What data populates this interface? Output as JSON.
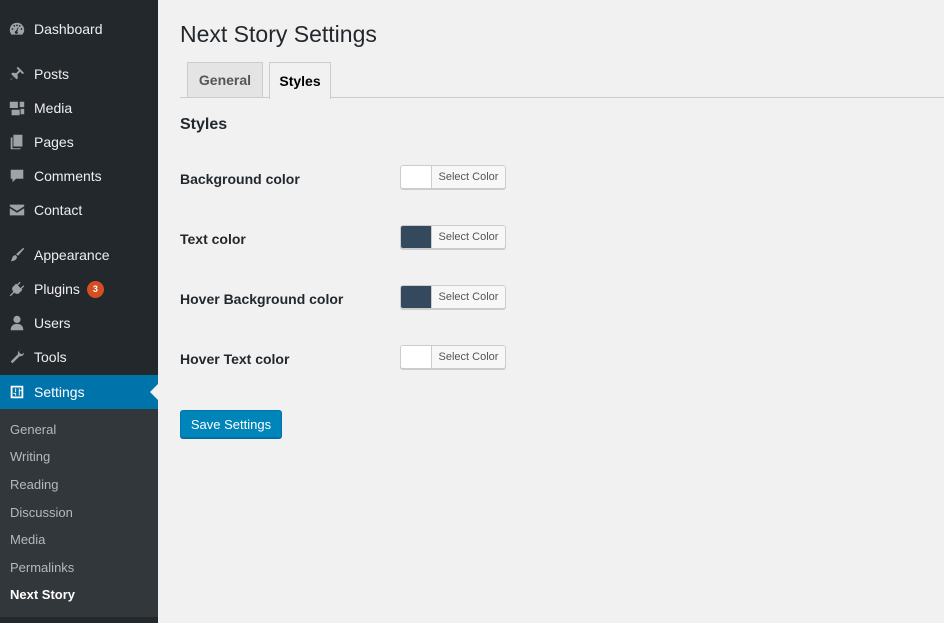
{
  "sidebar": {
    "items": [
      {
        "label": "Dashboard",
        "icon": "dashboard-icon"
      },
      {
        "label": "Posts",
        "icon": "pin-icon"
      },
      {
        "label": "Media",
        "icon": "media-icon"
      },
      {
        "label": "Pages",
        "icon": "pages-icon"
      },
      {
        "label": "Comments",
        "icon": "comment-icon"
      },
      {
        "label": "Contact",
        "icon": "envelope-icon"
      },
      {
        "label": "Appearance",
        "icon": "brush-icon"
      },
      {
        "label": "Plugins",
        "icon": "plug-icon",
        "badge": "3"
      },
      {
        "label": "Users",
        "icon": "user-icon"
      },
      {
        "label": "Tools",
        "icon": "wrench-icon"
      },
      {
        "label": "Settings",
        "icon": "settings-icon",
        "active": true
      }
    ],
    "submenu": [
      "General",
      "Writing",
      "Reading",
      "Discussion",
      "Media",
      "Permalinks",
      "Next Story"
    ],
    "submenu_current": "Next Story"
  },
  "page": {
    "title": "Next Story Settings",
    "tabs": [
      {
        "label": "General",
        "active": false
      },
      {
        "label": "Styles",
        "active": true
      }
    ],
    "section_title": "Styles",
    "fields": [
      {
        "label": "Background color",
        "button": "Select Color",
        "color": "#ffffff"
      },
      {
        "label": "Text color",
        "button": "Select Color",
        "color": "#34495e"
      },
      {
        "label": "Hover Background color",
        "button": "Select Color",
        "color": "#34495e"
      },
      {
        "label": "Hover Text color",
        "button": "Select Color",
        "color": "#ffffff"
      }
    ],
    "save_label": "Save Settings"
  },
  "colors": {
    "sidebar_bg": "#23282d",
    "submenu_bg": "#32373c",
    "accent": "#0073aa",
    "button": "#0085ba",
    "badge": "#d54e21"
  }
}
